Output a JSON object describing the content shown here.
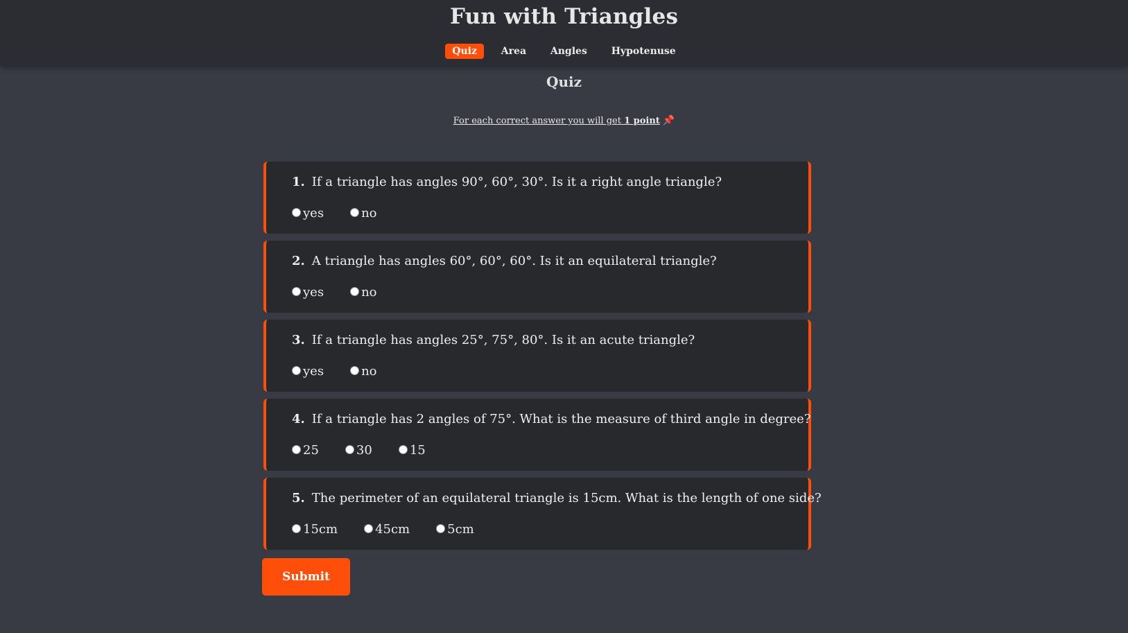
{
  "header": {
    "title": "Fun with Triangles",
    "nav": [
      {
        "label": "Quiz",
        "active": true
      },
      {
        "label": "Area",
        "active": false
      },
      {
        "label": "Angles",
        "active": false
      },
      {
        "label": "Hypotenuse",
        "active": false
      }
    ]
  },
  "main": {
    "heading": "Quiz",
    "note": {
      "prefix": "For each correct answer you will get ",
      "points": "1 point",
      "icon": "pushpin-icon"
    },
    "questions": [
      {
        "number": "1.",
        "text": "If a triangle has angles 90°, 60°, 30°. Is it a right angle triangle?",
        "options": [
          "yes",
          "no"
        ]
      },
      {
        "number": "2.",
        "text": "A triangle has angles 60°, 60°, 60°. Is it an equilateral triangle?",
        "options": [
          "yes",
          "no"
        ]
      },
      {
        "number": "3.",
        "text": "If a triangle has angles 25°, 75°, 80°. Is it an acute triangle?",
        "options": [
          "yes",
          "no"
        ]
      },
      {
        "number": "4.",
        "text": "If a triangle has 2 angles of 75°. What is the measure of third angle in degree?",
        "options": [
          "25",
          "30",
          "15"
        ]
      },
      {
        "number": "5.",
        "text": "The perimeter of an equilateral triangle is 15cm. What is the length of one side?",
        "options": [
          "15cm",
          "45cm",
          "5cm"
        ]
      }
    ],
    "submit_label": "Submit"
  },
  "colors": {
    "accent": "#ff4e0a",
    "background": "#383b44",
    "header": "#2b2d32",
    "card": "#28292d"
  }
}
